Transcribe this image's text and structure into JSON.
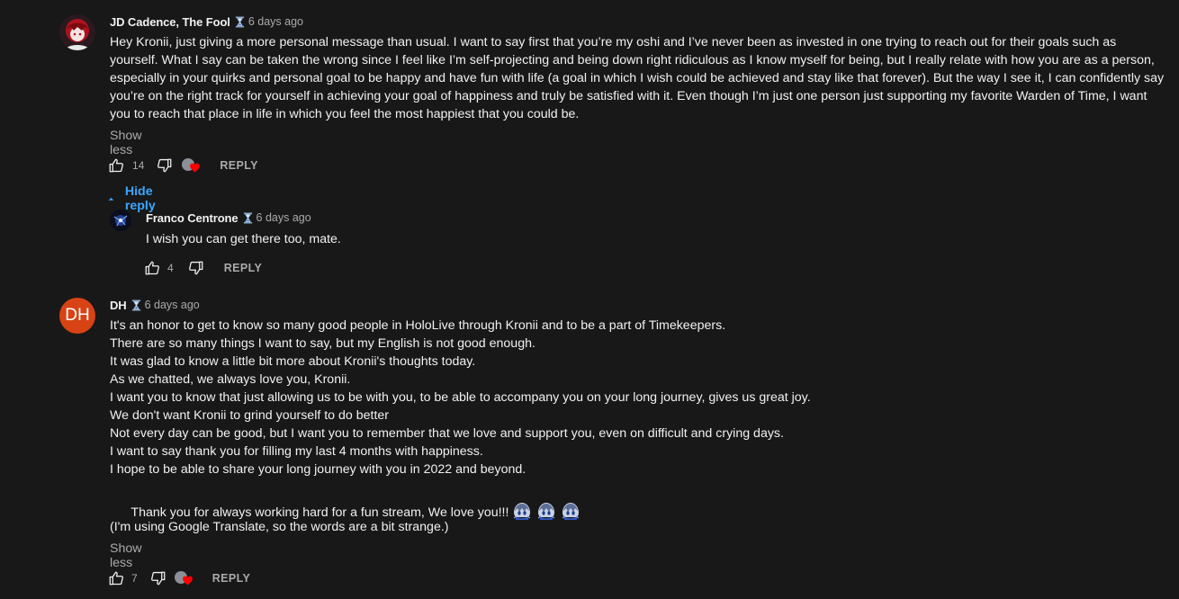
{
  "comments": [
    {
      "author": "JD Cadence, The Fool",
      "time": "6 days ago",
      "badge_icon": "hourglass-icon",
      "lines": [
        "Hey Kronii, just giving a more personal message than usual. I want to say first that you’re my oshi and I’ve never been as invested in one trying to reach out for their goals such as",
        "yourself. What I say can be taken the wrong since I feel like I’m self-projecting and being down right ridiculous as I know myself for being, but I really relate with how you are as a person,",
        "especially in your quirks and personal goal to be happy and have fun with life (a goal in which I wish could be achieved and stay like that forever). But the way I see it, I can confidently say",
        "you’re on the right track for yourself in achieving your goal of happiness and truly be satisfied with it. Even though I’m just one person just supporting my favorite Warden of Time, I want",
        "you to reach that place in life in which you feel the most happiest that you could be."
      ],
      "show_less": "Show less",
      "likes": "14",
      "reply": "REPLY",
      "hide_reply": "Hide reply"
    },
    {
      "author": "Franco Centrone",
      "time": "6 days ago",
      "badge_icon": "hourglass-icon",
      "lines": [
        "I wish you can get there too, mate."
      ],
      "likes": "4",
      "reply": "REPLY"
    },
    {
      "author": "DH",
      "avatar_initials": "DH",
      "avatar_color": "#d84315",
      "time": "6 days ago",
      "badge_icon": "hourglass-icon",
      "lines": [
        "It's an honor to get to know so many good people in HoloLive through Kronii and to be a part of Timekeepers.",
        "There are so many things I want to say, but my English is not good enough.",
        "It was glad to know a little bit more about Kronii's thoughts today.",
        "As we chatted, we always love you, Kronii.",
        "I want you to know that just allowing us to be with you, to be able to accompany you on your long journey, gives us great joy.",
        "We don't want Kronii to grind yourself to do better",
        "Not every day can be good, but I want you to remember that we love and support you, even on difficult and crying days.",
        "I want to say thank you for filling my last 4 months with happiness.",
        "I hope to be able to share your long journey with you in 2022 and beyond."
      ],
      "last_line": "Thank you for always working hard for a fun stream, We love you!!!",
      "note": "(I'm using Google Translate, so the words are a bit strange.)",
      "show_less": "Show less",
      "likes": "7",
      "reply": "REPLY"
    }
  ],
  "icons": {
    "like": "thumbs-up-icon",
    "dislike": "thumbs-down-icon",
    "hearted": "creator-heart-icon",
    "hide_reply": "chevron-up-icon",
    "emoji": "kronii-emote-icon"
  },
  "colors": {
    "background": "#181818",
    "text": "#f1f1f1",
    "secondary": "#aaaaaa",
    "link": "#3ea6ff",
    "heart": "#ff0000"
  }
}
